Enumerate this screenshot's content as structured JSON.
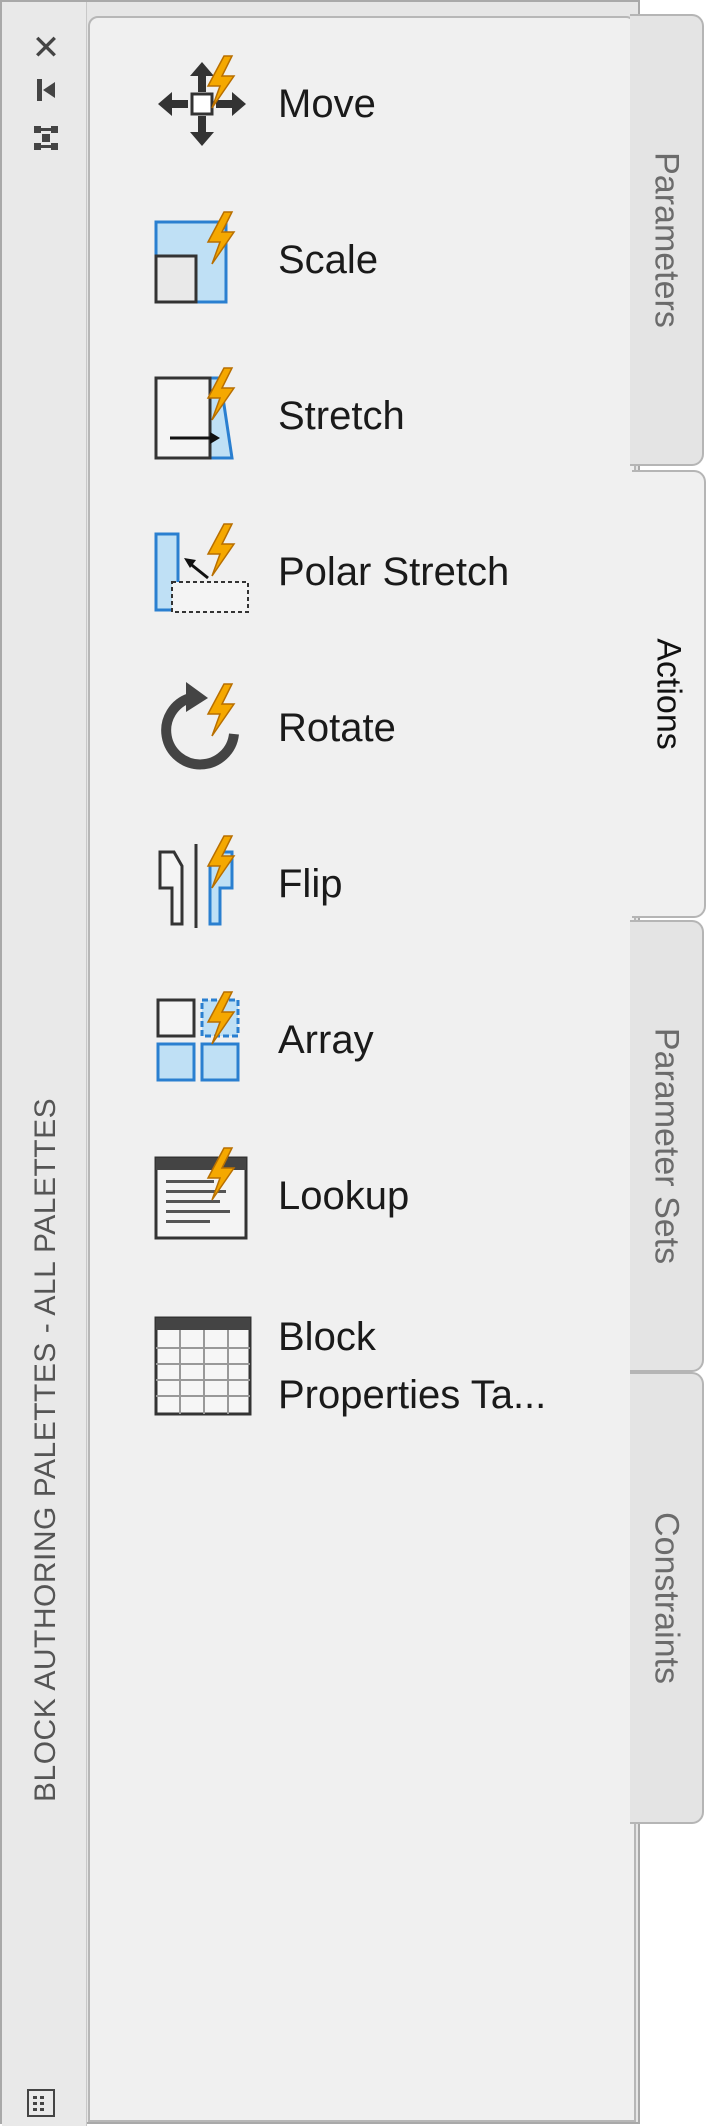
{
  "palette": {
    "title": "BLOCK AUTHORING PALETTES - ALL PALETTES",
    "controls": {
      "close_icon": "close-icon",
      "autohide_icon": "autohide-icon",
      "properties_icon": "properties-icon"
    },
    "tools": [
      {
        "label": "Move",
        "icon": "move-action-icon"
      },
      {
        "label": "Scale",
        "icon": "scale-action-icon"
      },
      {
        "label": "Stretch",
        "icon": "stretch-action-icon"
      },
      {
        "label": "Polar Stretch",
        "icon": "polar-stretch-action-icon"
      },
      {
        "label": "Rotate",
        "icon": "rotate-action-icon"
      },
      {
        "label": "Flip",
        "icon": "flip-action-icon"
      },
      {
        "label": "Array",
        "icon": "array-action-icon"
      },
      {
        "label": "Lookup",
        "icon": "lookup-action-icon"
      },
      {
        "label_line1": "Block",
        "label_line2": "Properties  Ta...",
        "icon": "block-properties-table-icon"
      }
    ],
    "tabs": [
      {
        "label": "Parameters",
        "active": false
      },
      {
        "label": "Actions",
        "active": true
      },
      {
        "label": "Parameter Sets",
        "active": false
      },
      {
        "label": "Constraints",
        "active": false
      }
    ],
    "colors": {
      "bolt": "#f5a800",
      "blue": "#2a7fd0",
      "light_blue": "#bfe0f5"
    }
  }
}
